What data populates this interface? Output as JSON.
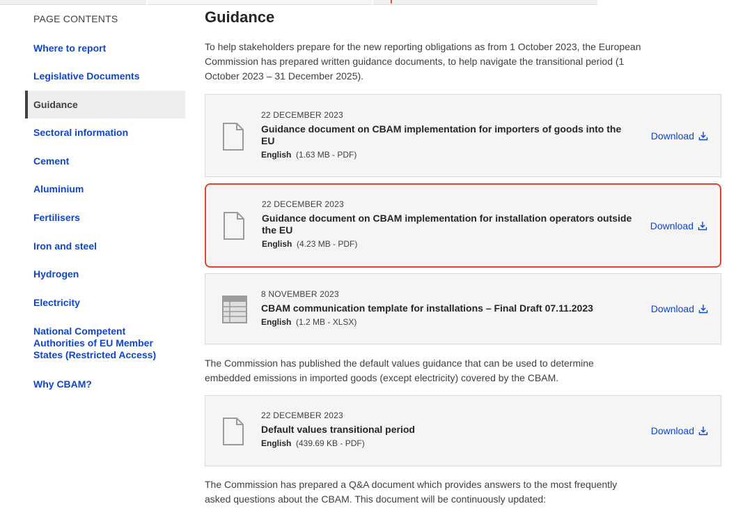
{
  "sidebar": {
    "heading": "PAGE CONTENTS",
    "items": [
      {
        "label": "Where to report"
      },
      {
        "label": "Legislative Documents"
      },
      {
        "label": "Guidance"
      },
      {
        "label": "Sectoral information"
      },
      {
        "label": "Cement"
      },
      {
        "label": "Aluminium"
      },
      {
        "label": "Fertilisers"
      },
      {
        "label": "Iron and steel"
      },
      {
        "label": "Hydrogen"
      },
      {
        "label": "Electricity"
      },
      {
        "label": "National Competent Authorities of EU Member States (Restricted Access)"
      },
      {
        "label": "Why CBAM?"
      }
    ],
    "active_item": "Guidance"
  },
  "main": {
    "title": "Guidance",
    "intro": "To help stakeholders prepare for the new reporting obligations as from 1 October 2023, the European Commission has prepared written guidance documents, to help navigate the transitional period (1 October 2023 – 31 December 2025).",
    "documents": [
      {
        "date": "22 DECEMBER 2023",
        "title": "Guidance document on CBAM implementation for importers of goods into the EU",
        "language": "English",
        "size": "(1.63 MB - PDF)",
        "download_label": "Download",
        "icon": "file-icon",
        "highlighted": false
      },
      {
        "date": "22 DECEMBER 2023",
        "title": "Guidance document on CBAM implementation for installation operators outside the EU",
        "language": "English",
        "size": "(4.23 MB - PDF)",
        "download_label": "Download",
        "icon": "file-icon",
        "highlighted": true
      },
      {
        "date": "8 NOVEMBER 2023",
        "title": "CBAM communication template for installations – Final Draft 07.11.2023",
        "language": "English",
        "size": "(1.2 MB - XLSX)",
        "download_label": "Download",
        "icon": "spreadsheet-icon",
        "highlighted": false
      }
    ],
    "default_values_text": "The Commission has published the default values guidance that can be used to determine embedded emissions in imported goods (except electricity) covered by the CBAM.",
    "default_values_doc": {
      "date": "22 DECEMBER 2023",
      "title": "Default values transitional period",
      "language": "English",
      "size": "(439.69 KB - PDF)",
      "download_label": "Download",
      "icon": "file-icon"
    },
    "qa_text": "The Commission has prepared a Q&A document which provides answers to the most frequently asked questions about the CBAM. This document will be continuously updated:"
  },
  "colors": {
    "link": "#0e47cb",
    "highlight_border": "#e0442b",
    "card_bg": "#f5f5f5"
  }
}
